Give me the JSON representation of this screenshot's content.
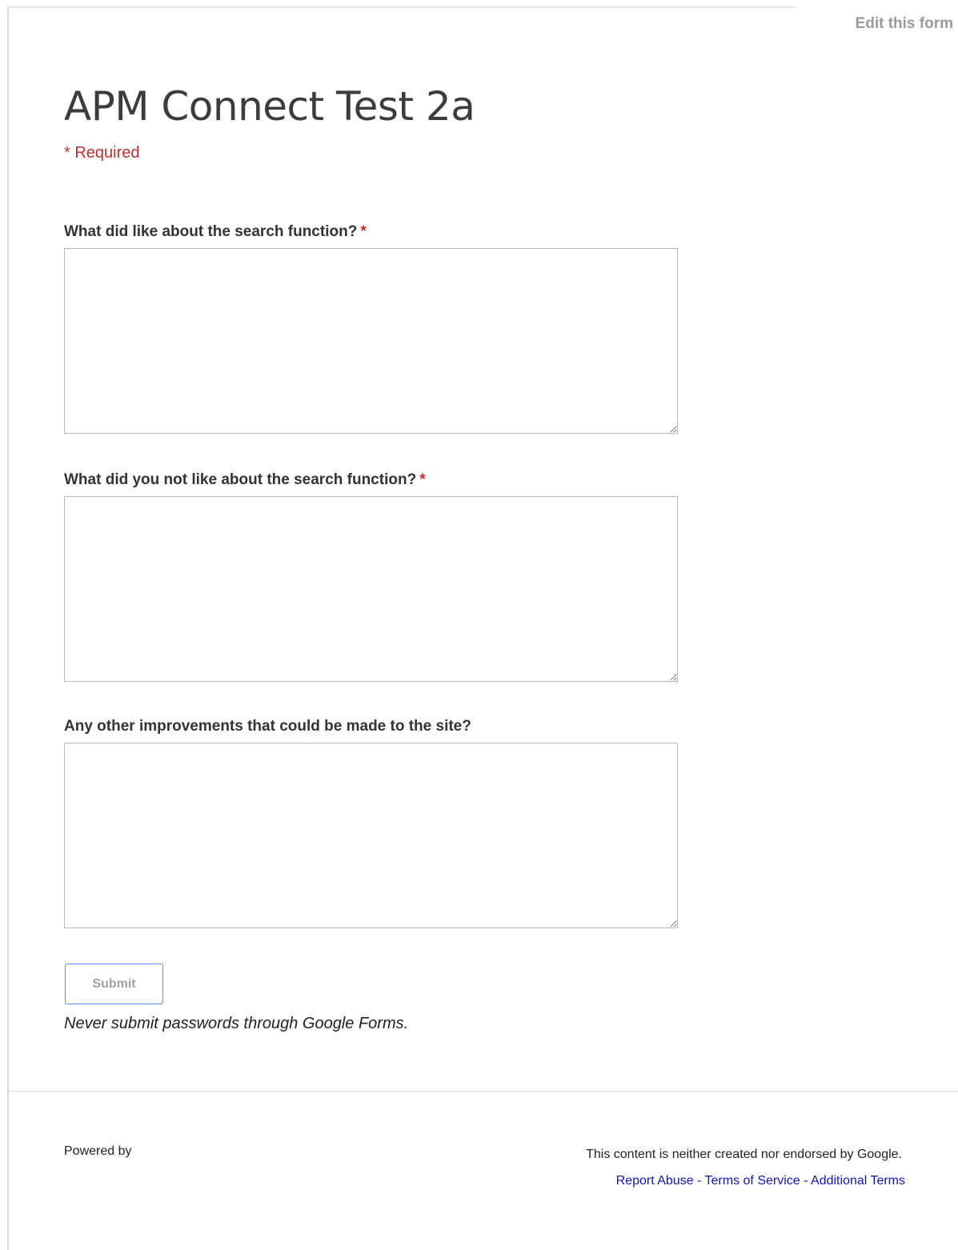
{
  "header": {
    "edit_link": "Edit this form"
  },
  "form": {
    "title": "APM Connect Test 2a",
    "required_note": "* Required",
    "questions": [
      {
        "label": "What did like about the search function?",
        "required_mark": "*",
        "value": ""
      },
      {
        "label": "What did you not like about the search function?",
        "required_mark": "*",
        "value": ""
      },
      {
        "label": "Any other improvements that could be made to the site?",
        "value": ""
      }
    ],
    "submit_label": "Submit",
    "password_warning": "Never submit passwords through Google Forms."
  },
  "footer": {
    "powered_by": "Powered by",
    "disclaimer": "This content is neither created nor endorsed by Google.",
    "links": [
      "Report Abuse",
      "Terms of Service",
      "Additional Terms"
    ],
    "separator": "-"
  },
  "colors": {
    "required_red": "#c5302c",
    "link_blue": "#1111cc",
    "submit_border": "#4d90fe"
  }
}
